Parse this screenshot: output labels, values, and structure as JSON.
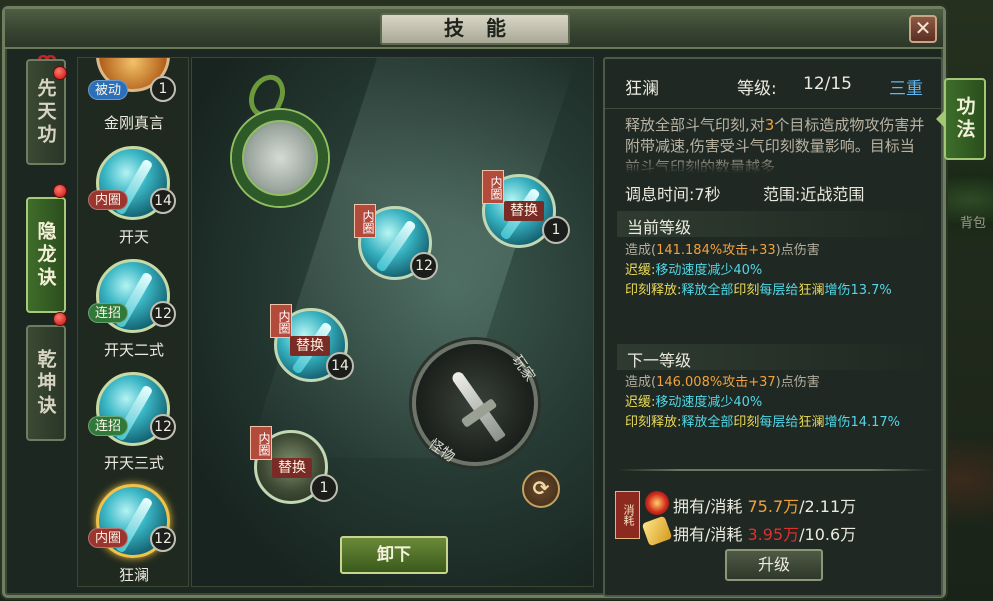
{
  "window": {
    "title": "技能",
    "close_label": "✕"
  },
  "left_tabs": [
    {
      "label": "先天功"
    },
    {
      "label": "隐龙诀"
    },
    {
      "label": "乾坤诀"
    }
  ],
  "skill_list": [
    {
      "name": "金刚真言",
      "tag": "被动",
      "level": "1"
    },
    {
      "name": "开天",
      "tag": "内圈",
      "level": "14"
    },
    {
      "name": "开天二式",
      "tag": "连招",
      "level": "12"
    },
    {
      "name": "开天三式",
      "tag": "连招",
      "level": "12"
    },
    {
      "name": "狂澜",
      "tag": "内圈",
      "level": "12"
    }
  ],
  "tree": {
    "nodes": [
      {
        "tag": "内圈",
        "label": "替换",
        "level": "1"
      },
      {
        "tag": "内圈",
        "label": "",
        "level": "12"
      },
      {
        "tag": "内圈",
        "label": "替换",
        "level": "14"
      },
      {
        "tag": "内圈",
        "label": "替换",
        "level": "1"
      }
    ],
    "weapon_label_top": "玩家",
    "weapon_label_bottom": "怪物",
    "unequip_label": "卸下"
  },
  "detail": {
    "skill_name": "狂澜",
    "level_label": "等级:",
    "level_value": "12/15",
    "tier": "三重",
    "description_parts": [
      "释放全部斗气印刻,对",
      "3",
      "个目标造成物攻伤害并附带减速,伤害受斗气印刻数量影响。目标当前斗气印刻的数量越多"
    ],
    "cooldown": "调息时间:7秒",
    "range": "范围:近战范围",
    "current": {
      "title": "当前等级",
      "damage_prefix": "造成(",
      "damage_value": "141.184%攻击+33",
      "damage_suffix": ")点伤害",
      "slow_label": "迟缓:",
      "slow_text": "移动速度减少40%",
      "release_label": "印刻释放:",
      "release_a": "释放全部",
      "release_b": "印刻",
      "release_c": "每层给",
      "release_d": "狂澜",
      "release_e": "增伤13.7%"
    },
    "next": {
      "title": "下一等级",
      "damage_prefix": "造成(",
      "damage_value": "146.008%攻击+37",
      "damage_suffix": ")点伤害",
      "slow_label": "迟缓:",
      "slow_text": "移动速度减少40%",
      "release_label": "印刻释放:",
      "release_a": "释放全部",
      "release_b": "印刻",
      "release_c": "每层给",
      "release_d": "狂澜",
      "release_e": "增伤14.17%"
    },
    "cost_label": "消耗",
    "costs": [
      {
        "label": "拥有/消耗",
        "owned": "75.7万",
        "required": "/2.11万",
        "icon": "gem-icon"
      },
      {
        "label": "拥有/消耗",
        "owned": "3.95万",
        "required": "/10.6万",
        "icon": "gold-icon"
      }
    ],
    "upgrade_label": "升级"
  },
  "side_tab": {
    "label": "功法"
  },
  "world": {
    "backpack_label": "背包"
  }
}
